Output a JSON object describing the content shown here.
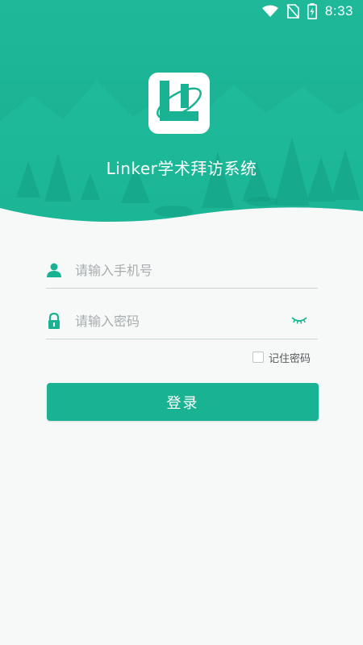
{
  "status_bar": {
    "time": "8:33",
    "icons": [
      "wifi-icon",
      "no-sim-icon",
      "battery-charging-icon"
    ]
  },
  "header": {
    "app_title": "Linker学术拜访系统",
    "logo_icon": "linker-logo-icon"
  },
  "login_form": {
    "phone": {
      "placeholder": "请输入手机号",
      "value": "",
      "icon": "user-icon"
    },
    "password": {
      "placeholder": "请输入密码",
      "value": "",
      "icon": "lock-icon",
      "toggle_icon": "eye-closed-icon"
    },
    "remember": {
      "label": "记住密码",
      "checked": false
    },
    "submit_label": "登录"
  },
  "colors": {
    "accent": "#19b394",
    "header_dark": "#12a487",
    "background": "#f7f8f8"
  }
}
